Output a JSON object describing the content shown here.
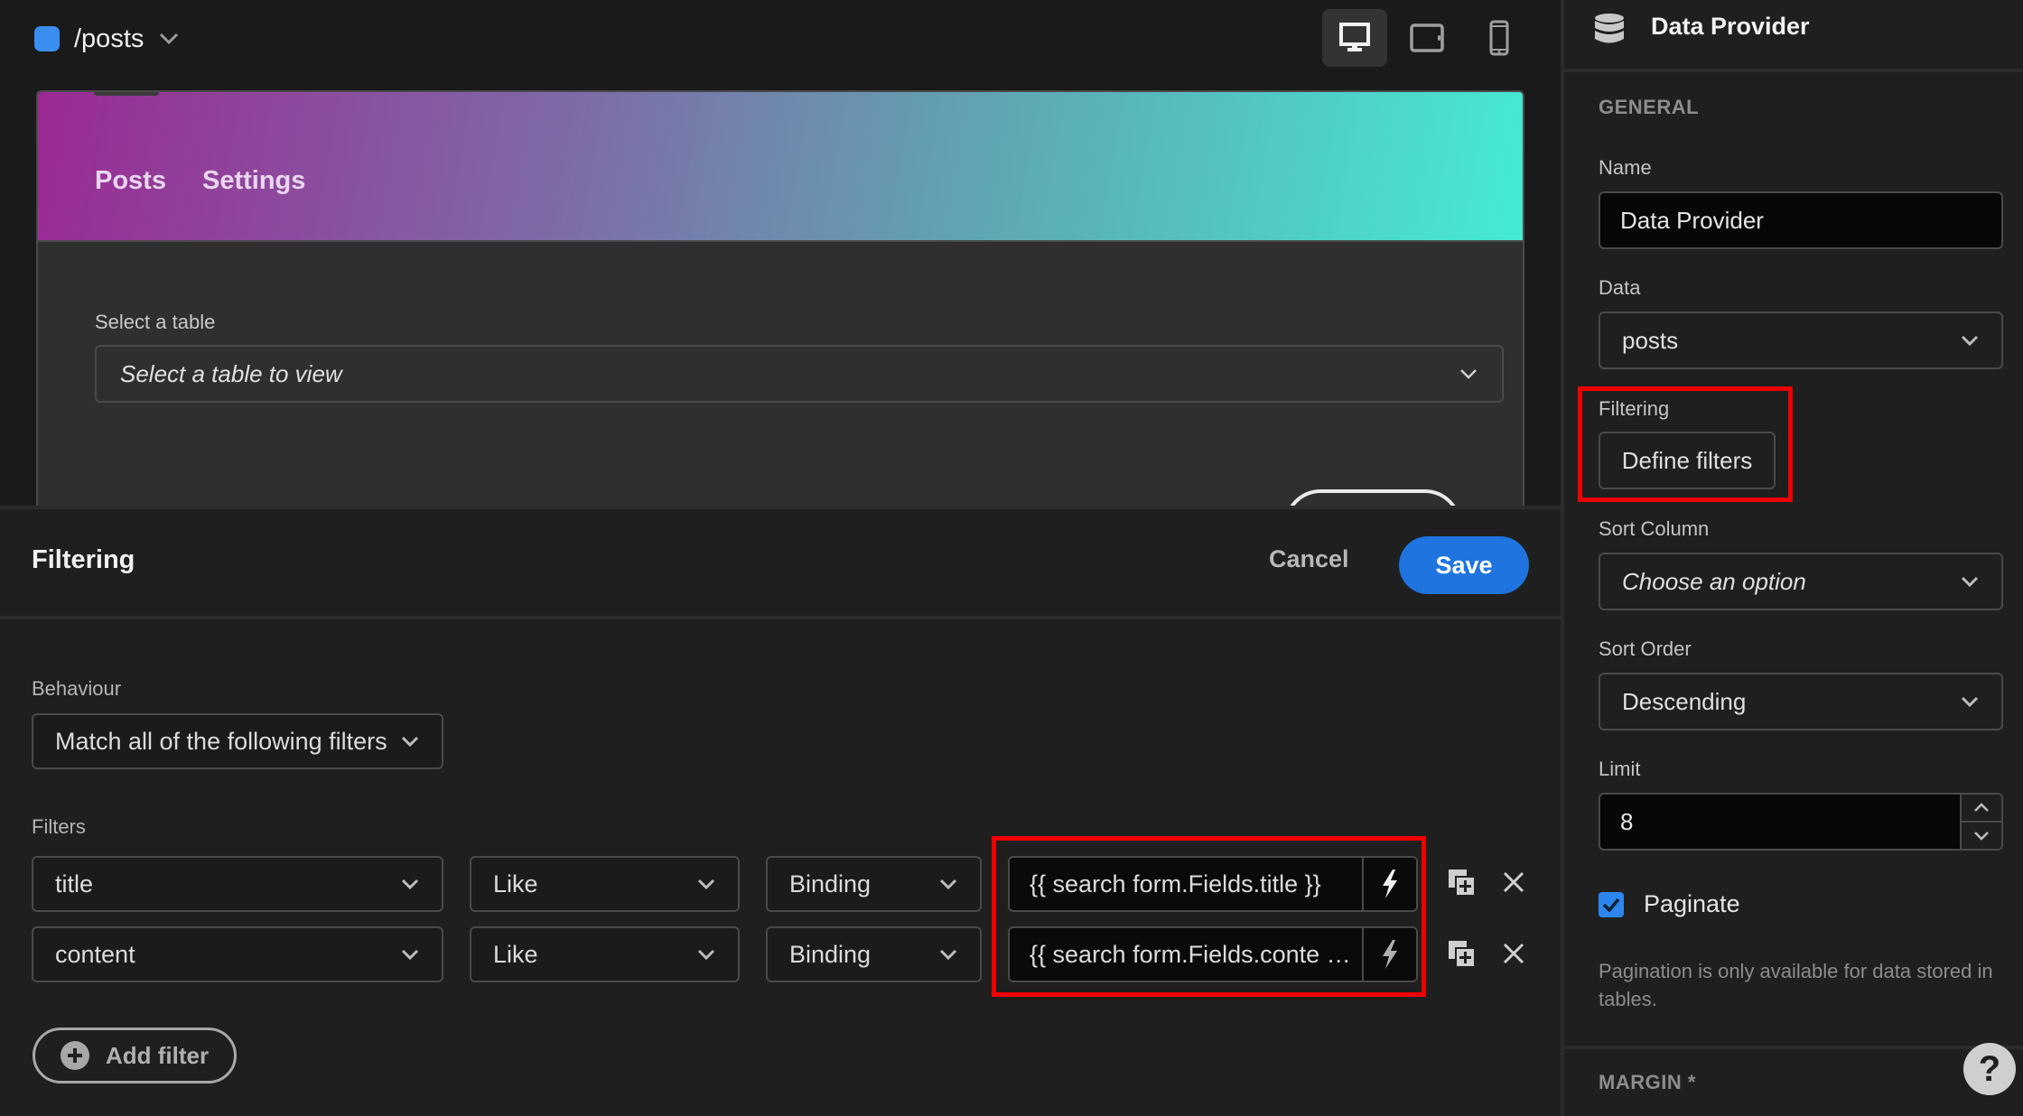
{
  "topbar": {
    "route": "/posts",
    "route_color": "#3a8ef0",
    "devices": [
      {
        "name": "desktop",
        "icon": "desktop-icon",
        "active": true
      },
      {
        "name": "tablet",
        "icon": "tablet-icon",
        "active": false
      },
      {
        "name": "mobile",
        "icon": "mobile-icon",
        "active": false
      }
    ]
  },
  "preview": {
    "nav": [
      "Posts",
      "Settings"
    ],
    "select_label": "Select a table",
    "select_placeholder": "Select a table to view"
  },
  "modal": {
    "title": "Filtering",
    "cancel_label": "Cancel",
    "save_label": "Save",
    "save_color": "#1f74e0",
    "behaviour_label": "Behaviour",
    "behaviour_value": "Match all of the following filters",
    "filters_label": "Filters",
    "filters": [
      {
        "field": "title",
        "operator": "Like",
        "type": "Binding",
        "value": "{{ search form.Fields.title }}"
      },
      {
        "field": "content",
        "operator": "Like",
        "type": "Binding",
        "value": "{{ search form.Fields.conte  …"
      }
    ],
    "add_filter_label": "Add filter"
  },
  "panel": {
    "title": "Data Provider",
    "section_general": "GENERAL",
    "name_label": "Name",
    "name_value": "Data Provider",
    "data_label": "Data",
    "data_value": "posts",
    "filtering_label": "Filtering",
    "define_filters_label": "Define filters",
    "sort_column_label": "Sort Column",
    "sort_column_placeholder": "Choose an option",
    "sort_order_label": "Sort Order",
    "sort_order_value": "Descending",
    "limit_label": "Limit",
    "limit_value": "8",
    "paginate_label": "Paginate",
    "paginate_checked": true,
    "pagination_help": "Pagination is only available for data stored in tables.",
    "section_margin": "MARGIN *",
    "help_label": "?"
  }
}
